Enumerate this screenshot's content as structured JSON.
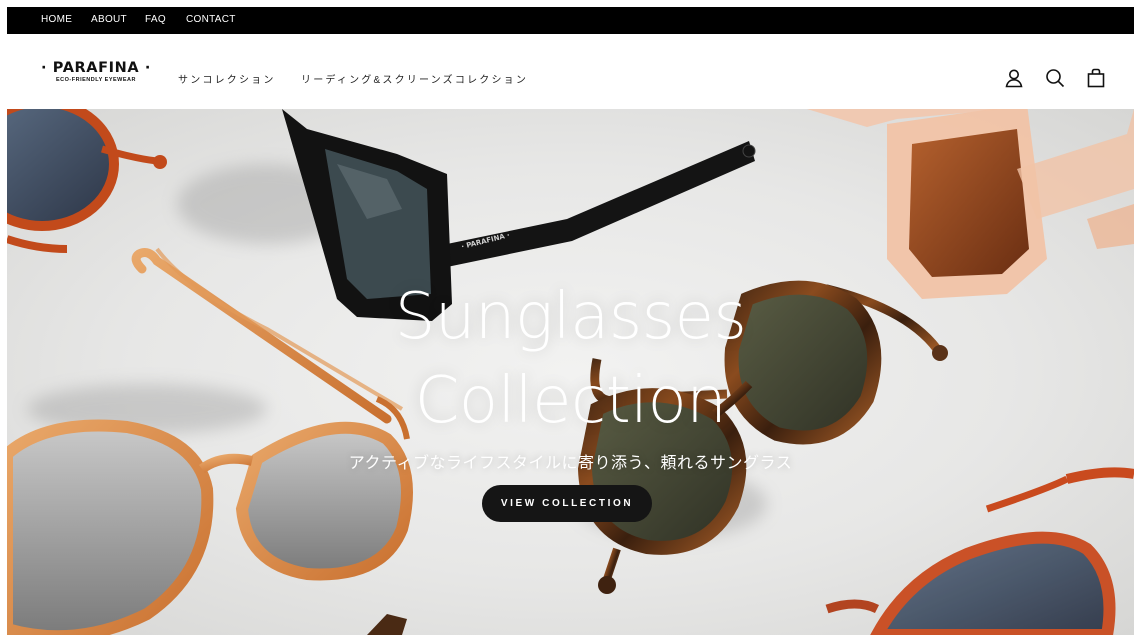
{
  "util_nav": [
    "HOME",
    "ABOUT",
    "FAQ",
    "CONTACT"
  ],
  "brand": {
    "name": "· PARAFINA ·",
    "tagline": "ECO-FRIENDLY EYEWEAR"
  },
  "main_nav": [
    "サンコレクション",
    "リーディング&スクリーンズコレクション"
  ],
  "header_icons": [
    "account-icon",
    "search-icon",
    "cart-icon"
  ],
  "hero": {
    "title_line1": "Sunglasses",
    "title_line2": "Collection",
    "subtitle": "アクティブなライフスタイルに寄り添う、頼れるサングラス",
    "cta_label": "VIEW COLLECTION",
    "temple_print": "· PARAFINA ·"
  },
  "colors": {
    "util_bar": "#000000",
    "cta": "#151515",
    "hero_bg": "#e7e7e6"
  }
}
